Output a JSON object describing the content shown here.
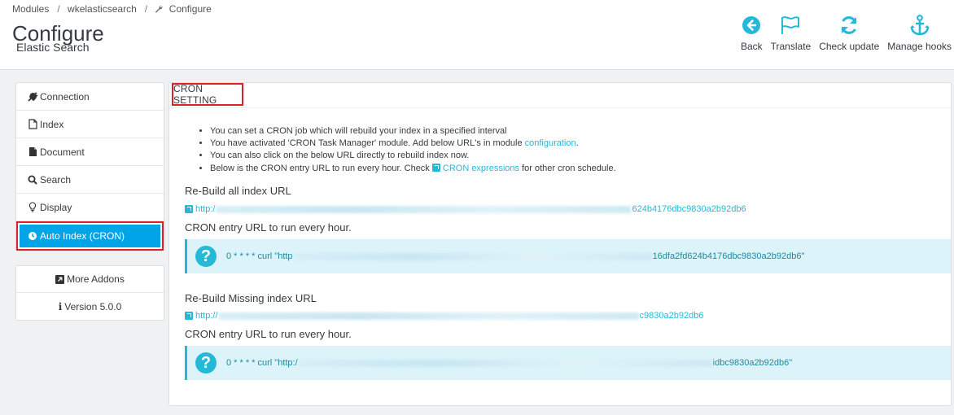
{
  "header": {
    "breadcrumb": [
      "Modules",
      "wkelasticsearch",
      "Configure"
    ],
    "title": "Configure",
    "subtitle": "Elastic Search",
    "toolbar": [
      {
        "label": "Back",
        "icon": "back-arrow-icon"
      },
      {
        "label": "Translate",
        "icon": "flag-icon"
      },
      {
        "label": "Check update",
        "icon": "refresh-icon"
      },
      {
        "label": "Manage hooks",
        "icon": "anchor-icon"
      }
    ]
  },
  "sidebar": {
    "items": [
      {
        "label": "Connection",
        "icon": "plug-icon"
      },
      {
        "label": "Index",
        "icon": "file-icon"
      },
      {
        "label": "Document",
        "icon": "document-icon"
      },
      {
        "label": "Search",
        "icon": "search-icon"
      },
      {
        "label": "Display",
        "icon": "lightbulb-icon"
      },
      {
        "label": "Auto Index (CRON)",
        "icon": "clock-icon",
        "active": true
      }
    ],
    "addons": [
      {
        "label": "More Addons",
        "icon": "external-link-icon"
      },
      {
        "label": "Version 5.0.0",
        "icon": "info-icon"
      }
    ]
  },
  "panel": {
    "heading": "CRON SETTING",
    "info": {
      "line1": "You can set a CRON job which will rebuild your index in a specified interval",
      "line2_pre": "You have activated 'CRON Task Manager' module. Add below URL's in module ",
      "line2_link": "configuration",
      "line2_post": ".",
      "line3": "You can also click on the below URL directly to rebuild index now.",
      "line4_pre": "Below is the CRON entry URL to run every hour. Check ",
      "line4_link": "CRON expressions",
      "line4_post": " for other cron schedule."
    },
    "rebuild_all": {
      "title": "Re-Build all index URL",
      "url_start": "http:/",
      "url_end": "624b4176dbc9830a2b92db6",
      "cron_label": "CRON entry URL to run every hour.",
      "cron_start": "0 * * * * curl \"http",
      "cron_end": "16dfa2fd624b4176dbc9830a2b92db6\""
    },
    "rebuild_missing": {
      "title": "Re-Build Missing index URL",
      "url_start": "http://",
      "url_end": "c9830a2b92db6",
      "cron_label": "CRON entry URL to run every hour.",
      "cron_start": "0 * * * * curl \"http:/",
      "cron_end": "idbc9830a2b92db6\""
    }
  },
  "colors": {
    "accent": "#25b9d7",
    "active": "#00a4e7",
    "highlight": "#d9222a"
  }
}
